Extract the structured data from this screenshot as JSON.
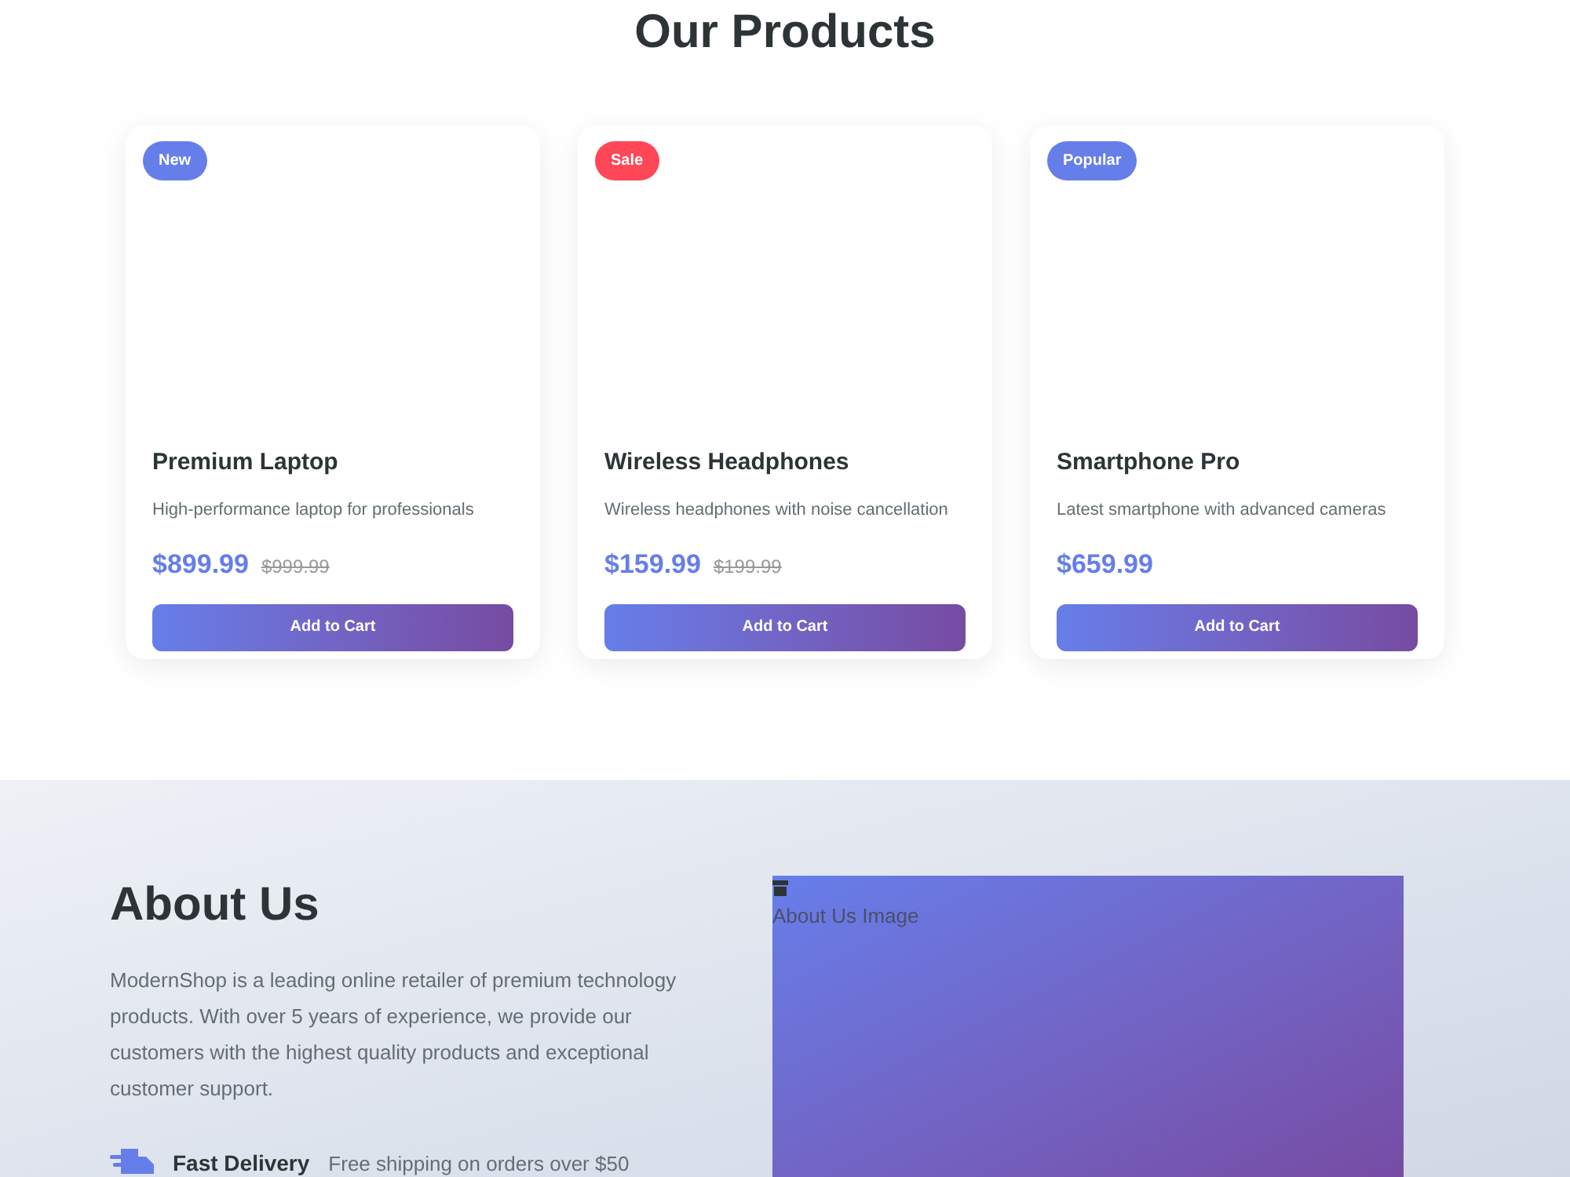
{
  "products_section": {
    "title": "Our Products",
    "products": [
      {
        "badge": {
          "label": "New",
          "color": "#667eea"
        },
        "name": "Premium Laptop",
        "description": "High-performance laptop for professionals",
        "price": "$899.99",
        "old_price": "$999.99",
        "button": "Add to Cart"
      },
      {
        "badge": {
          "label": "Sale",
          "color": "#ff4757"
        },
        "name": "Wireless Headphones",
        "description": "Wireless headphones with noise cancellation",
        "price": "$159.99",
        "old_price": "$199.99",
        "button": "Add to Cart"
      },
      {
        "badge": {
          "label": "Popular",
          "color": "#667eea"
        },
        "name": "Smartphone Pro",
        "description": "Latest smartphone with advanced cameras",
        "price": "$659.99",
        "button": "Add to Cart"
      }
    ]
  },
  "about_section": {
    "title": "About Us",
    "paragraph": "ModernShop is a leading online retailer of premium technology products. With over 5 years of experience, we provide our customers with the highest quality products and exceptional customer support.",
    "features": [
      {
        "title": "Fast Delivery",
        "description": "Free shipping on orders over $50"
      }
    ],
    "image_alt": "About Us Image"
  }
}
